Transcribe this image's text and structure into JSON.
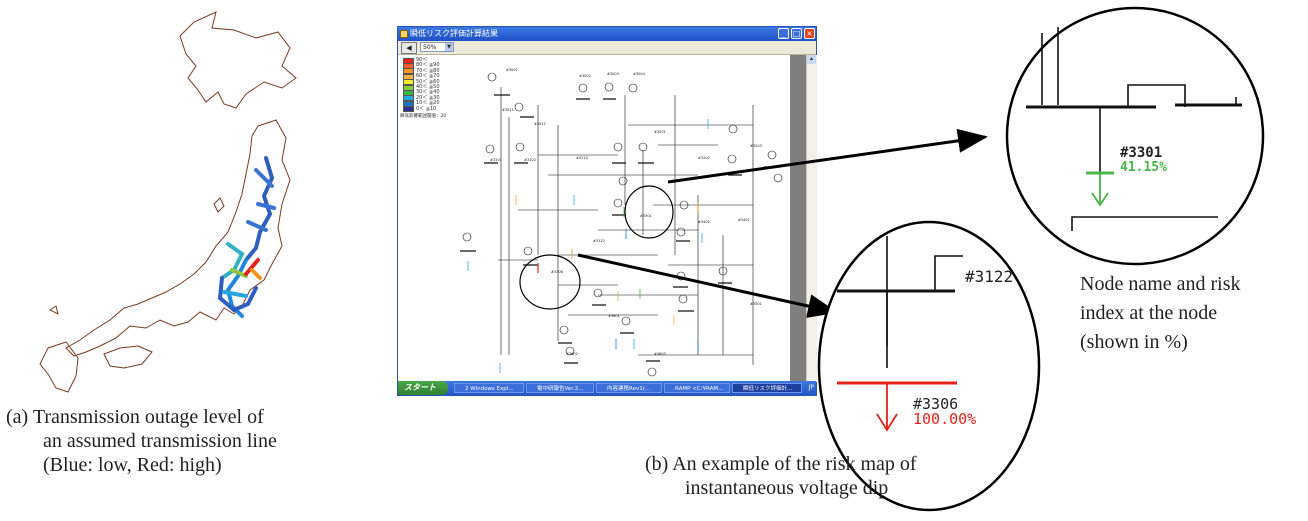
{
  "window": {
    "title": "瞬低リスク評価計算結果",
    "zoom_value": "50%",
    "threshold_label": "瞬低影響範囲閾値：20"
  },
  "legend": {
    "items": [
      {
        "label": "90＜",
        "color": "#e2231a"
      },
      {
        "label": "80＜ ≦90",
        "color": "#ef5a2a"
      },
      {
        "label": "70＜ ≦80",
        "color": "#f7941d"
      },
      {
        "label": "60＜ ≦70",
        "color": "#fbb040"
      },
      {
        "label": "50＜ ≦60",
        "color": "#f9ed32"
      },
      {
        "label": "40＜ ≦50",
        "color": "#8dc63f"
      },
      {
        "label": "30＜ ≦40",
        "color": "#39b54a"
      },
      {
        "label": "20＜ ≦30",
        "color": "#27aae1"
      },
      {
        "label": "10＜ ≦20",
        "color": "#1c75bc"
      },
      {
        "label": "0＜ ≦10",
        "color": "#2e3192"
      }
    ]
  },
  "taskbar": {
    "start": "スタート",
    "items": [
      "2 Windows Expl...",
      "電中研報告Ver.2...",
      "内容連携Rev1(...",
      "RAMP <C:¥RAM...",
      "瞬低リスク評価計..."
    ],
    "ime": "JP"
  },
  "zoom_right": {
    "node_name": "#3301",
    "risk_index": "41.15%",
    "risk_color": "#49b648"
  },
  "zoom_bottom": {
    "node_upper": "#3122",
    "node_lower": "#3306",
    "risk_index": "100.00%",
    "risk_color": "#e2231a"
  },
  "node_note": {
    "lines": [
      "Node name and risk",
      "index at the node",
      "(shown in %)"
    ]
  },
  "caption_a": {
    "line1": "(a) Transmission outage level of",
    "line2": "an assumed transmission line",
    "line3": "(Blue: low, Red: high)"
  },
  "caption_b": {
    "line1": "(b) An example of the risk map of",
    "line2": "instantaneous voltage dip"
  }
}
